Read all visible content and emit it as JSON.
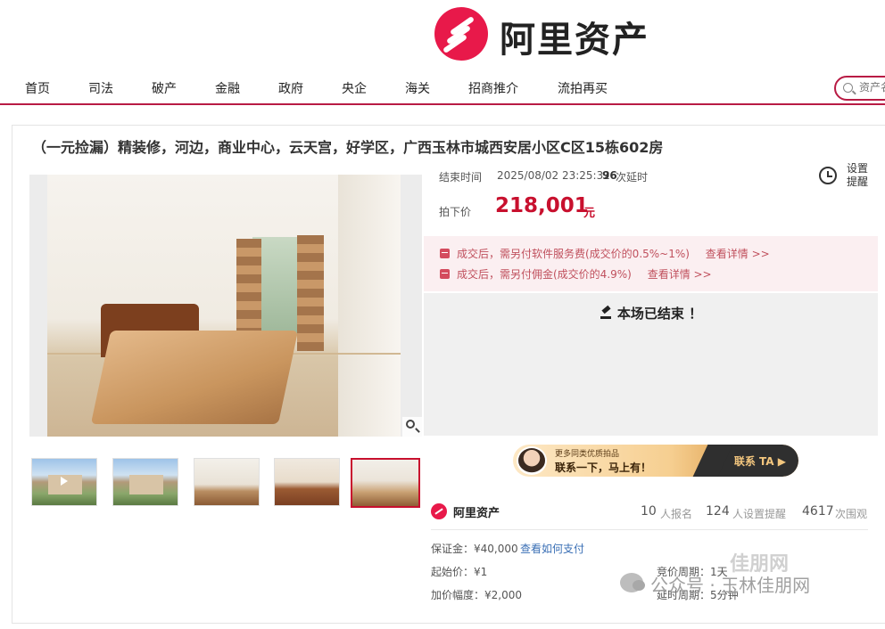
{
  "brand": {
    "name": "阿里资产",
    "accent": "#e8194a"
  },
  "nav": {
    "items": [
      "首页",
      "司法",
      "破产",
      "金融",
      "政府",
      "央企",
      "海关",
      "招商推介",
      "流拍再买"
    ],
    "search_placeholder": "资产名"
  },
  "item": {
    "title": "（一元捡漏）精装修，河边，商业中心，云天宫，好学区，广西玉林市城西安居小区C区15栋602房",
    "end_label": "结束时间",
    "end_time": "2025/08/02 23:25:32",
    "delay_count": "96",
    "delay_label": "次延时",
    "price_label": "拍下价",
    "price": "218,001",
    "price_unit": "元",
    "remind_label": "设置提醒",
    "fees": [
      {
        "text": "成交后，需另付软件服务费(成交价的0.5%~1%)",
        "link": "查看详情 >>"
      },
      {
        "text": "成交后，需另付佣金(成交价的4.9%)",
        "link": "查看详情 >>"
      }
    ],
    "ended_text": "本场已结束 ！",
    "promo": {
      "line1": "更多同类优质拍品",
      "line2": "联系一下，马上有！",
      "button": "联系 TA ▶"
    }
  },
  "gallery": {
    "thumbnails": [
      "exterior-video",
      "exterior",
      "living-room",
      "dining-room",
      "bedroom"
    ],
    "active_index": 4
  },
  "org": {
    "name": "阿里资产",
    "stats": [
      {
        "value": "10",
        "label": "人报名"
      },
      {
        "value": "124",
        "label": "人设置提醒"
      },
      {
        "value": "4617",
        "label": "次围观"
      }
    ]
  },
  "details": {
    "deposit": "保证金：¥40,000",
    "deposit_link": "查看如何支付",
    "start_price": "起始价：¥1",
    "increment": "加价幅度：¥2,000",
    "bid_period": "竞价周期：1天",
    "delay_period": "延时周期：5分钟"
  },
  "watermark": {
    "text": "公众号 · 玉林佳朋网",
    "brand": "佳朋网"
  }
}
